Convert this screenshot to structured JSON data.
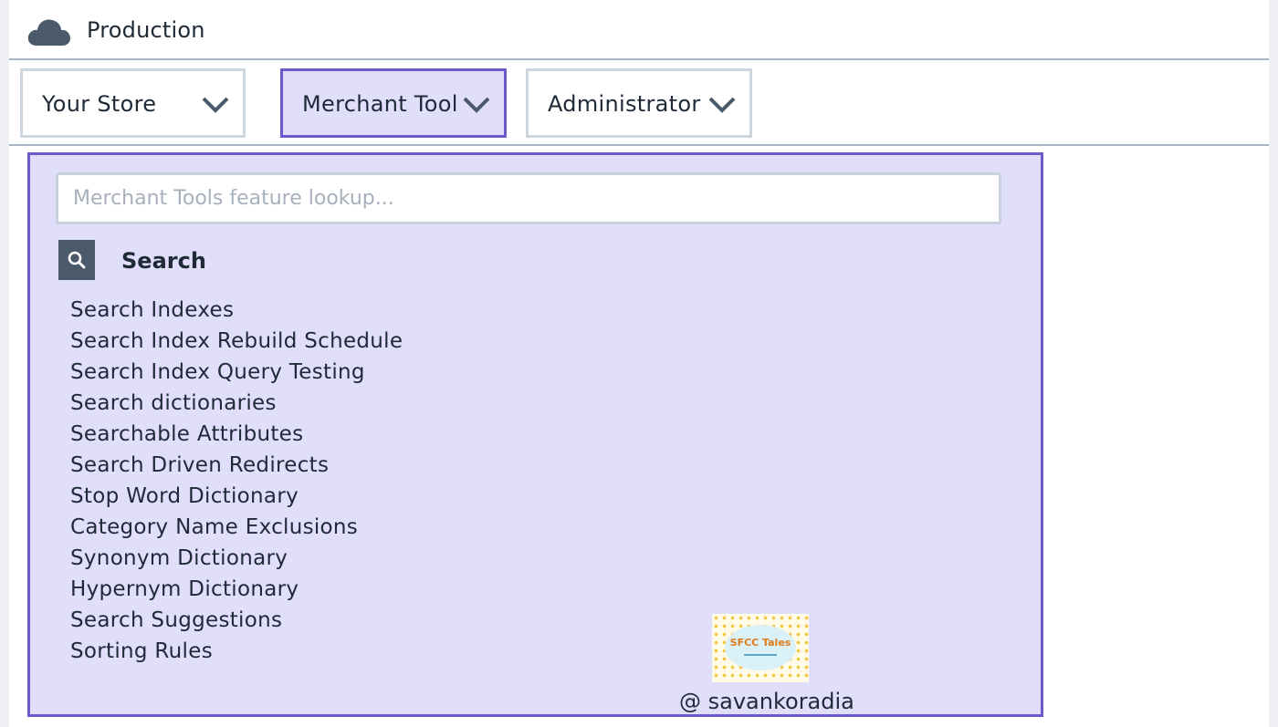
{
  "header": {
    "environment": "Production",
    "icon": "cloud-icon"
  },
  "nav": {
    "dropdowns": [
      {
        "label": "Your Store",
        "icon": "chevron-down-icon",
        "active": false
      },
      {
        "label": "Merchant Tool",
        "icon": "chevron-down-icon",
        "active": true
      },
      {
        "label": "Administrator",
        "icon": "chevron-down-icon",
        "active": false
      }
    ]
  },
  "menu": {
    "lookup_placeholder": "Merchant Tools feature lookup...",
    "section": {
      "icon": "search-icon",
      "title": "Search",
      "items": [
        "Search Indexes",
        "Search Index Rebuild Schedule",
        "Search Index Query Testing",
        "Search dictionaries",
        "Searchable Attributes",
        "Search Driven Redirects",
        "Stop Word Dictionary",
        "Category Name Exclusions",
        "Synonym Dictionary",
        "Hypernym Dictionary",
        "Search Suggestions",
        "Sorting Rules"
      ]
    }
  },
  "watermark": {
    "logo_text": "SFCC Tales",
    "credit": "@ savankoradia"
  },
  "colors": {
    "accent": "#6a5acd",
    "panel_bg": "#e0defa",
    "icon_dark": "#4a5a6b",
    "divider": "#a8b4c2"
  }
}
